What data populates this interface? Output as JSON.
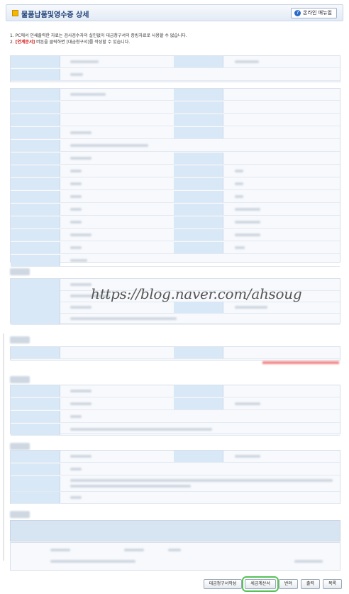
{
  "header": {
    "title": "물품납품및영수증 상세",
    "manual_label": "온라인 매뉴얼"
  },
  "notes": {
    "line1": "1.  PC에서 인쇄출력한 자료는 검사검수자의 실인없이 대금청구서의 증빙자료로 사용할 수 없습니다.",
    "line2_prefix": "2.  ",
    "line2_red": "[연계문서]",
    "line2_suffix": " 버튼을 클릭하면 [대금청구서]를 작성할 수 있습니다."
  },
  "watermark": "https://blog.naver.com/ahsoug",
  "buttons": {
    "invoice_request": "대금청구서작성",
    "tax_invoice": "세금계산서",
    "return": "반려",
    "print": "출력",
    "list": "목록"
  },
  "colors": {
    "title": "#1d3f77",
    "label_bg": "#d9e8f6",
    "highlight": "#56c256",
    "warning": "#d21d1d"
  }
}
